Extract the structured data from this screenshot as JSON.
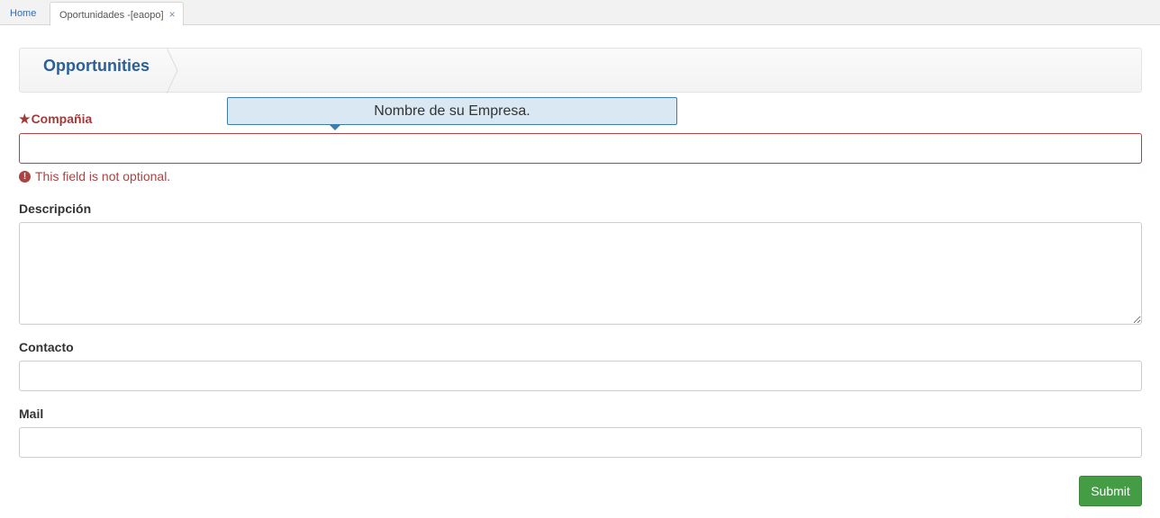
{
  "tabs": {
    "home_label": "Home",
    "active_label": "Oportunidades -[eaopo]",
    "close_glyph": "×"
  },
  "header": {
    "title": "Opportunities"
  },
  "tooltip": {
    "text": "Nombre de su Empresa."
  },
  "form": {
    "company": {
      "star": "★",
      "label": "Compañia",
      "value": "",
      "error_icon": "!",
      "error": "This field is not optional."
    },
    "description": {
      "label": "Descripción",
      "value": ""
    },
    "contact": {
      "label": "Contacto",
      "value": ""
    },
    "mail": {
      "label": "Mail",
      "value": ""
    },
    "submit_label": "Submit"
  },
  "colors": {
    "accent": "#2a5f9a",
    "error": "#a94442",
    "submit": "#449d44",
    "tooltip_bg": "#d9e8f2"
  }
}
